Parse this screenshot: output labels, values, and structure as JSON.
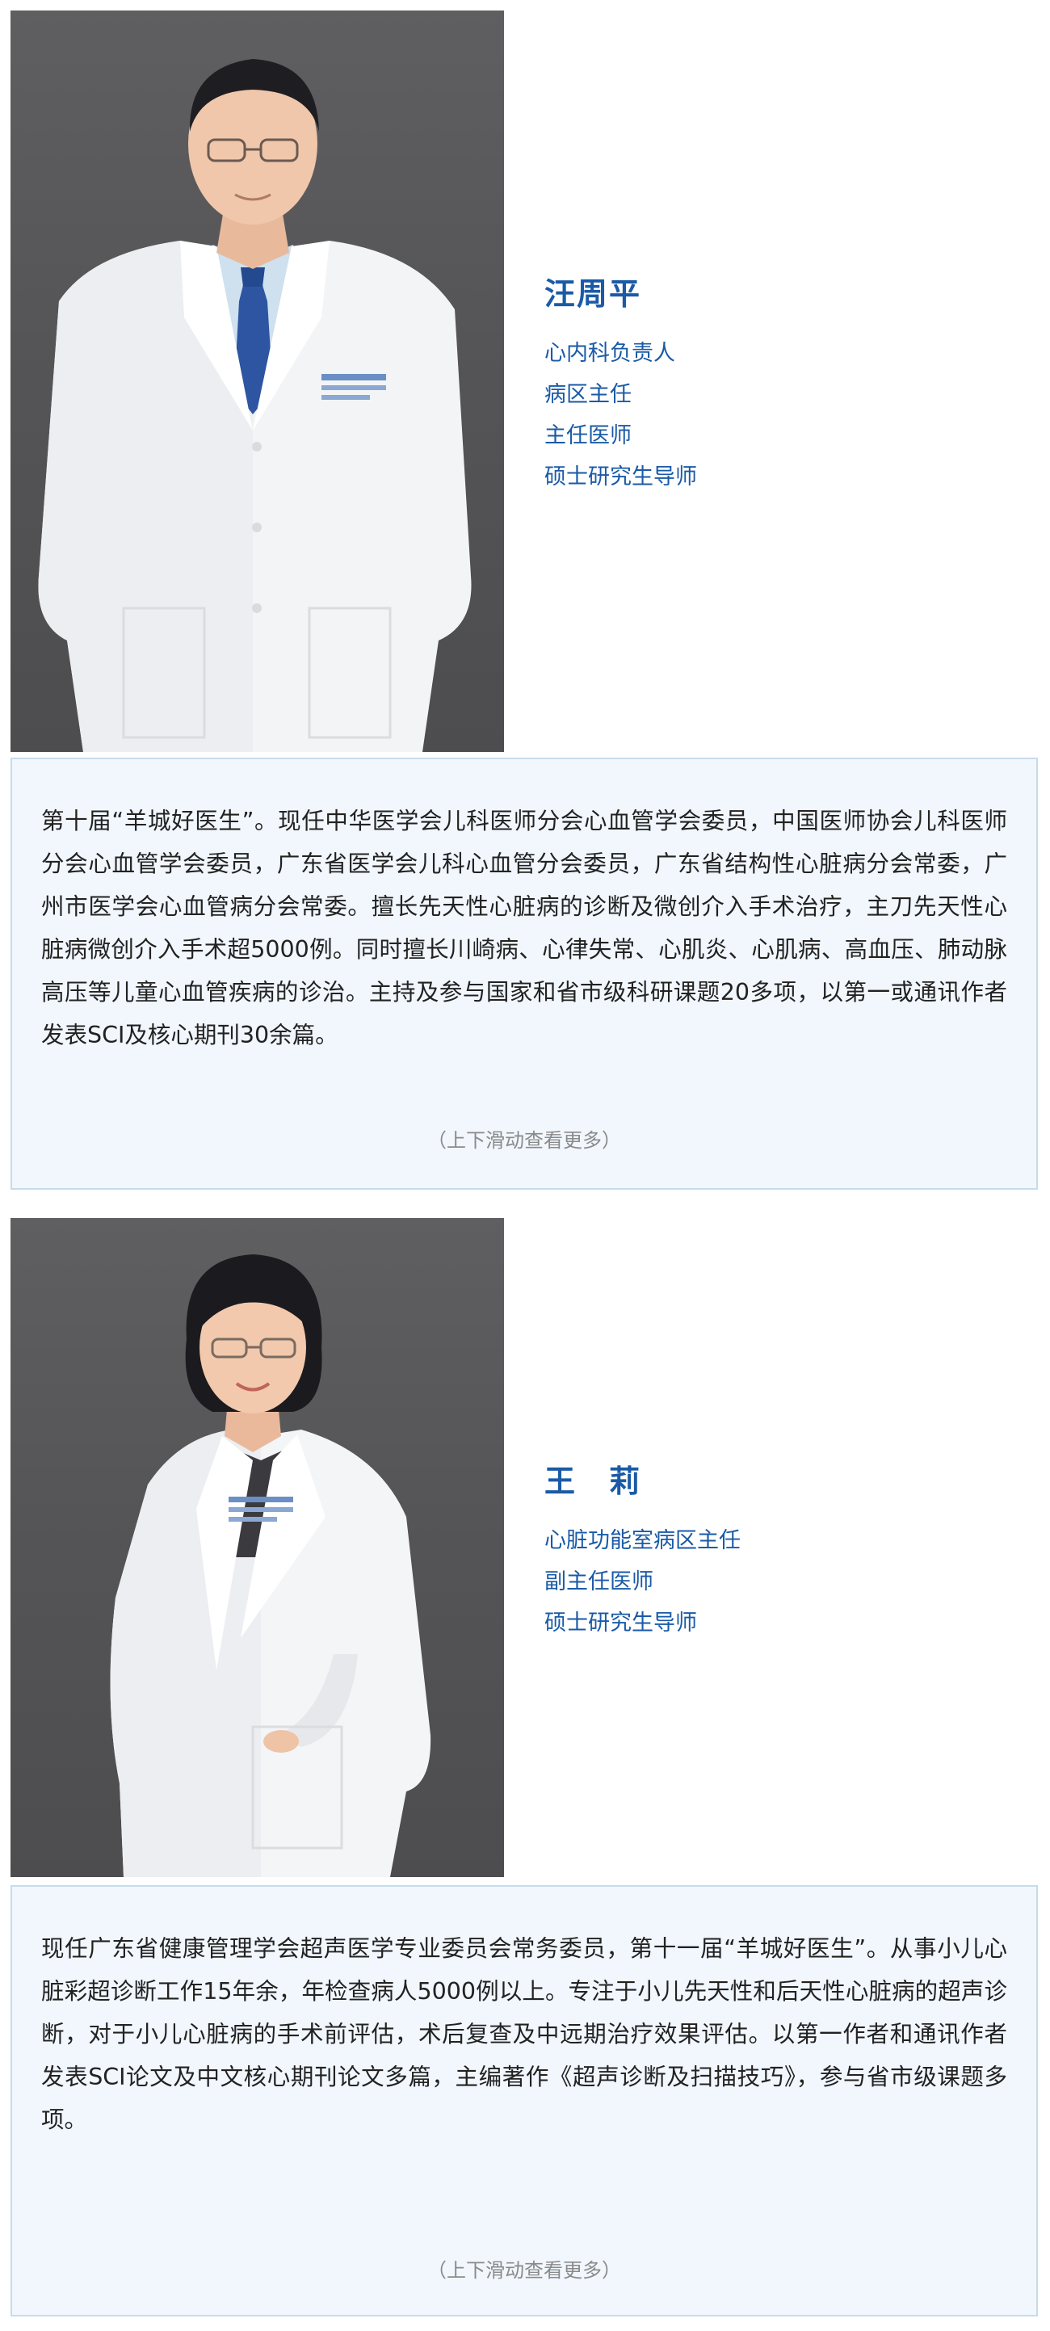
{
  "doctors": [
    {
      "name": "汪周平",
      "titles": [
        "心内科负责人",
        "病区主任",
        "主任医师",
        "硕士研究生导师"
      ],
      "bio": "第十届“羊城好医生”。现任中华医学会儿科医师分会心血管学会委员，中国医师协会儿科医师分会心血管学会委员，广东省医学会儿科心血管分会委员，广东省结构性心脏病分会常委，广州市医学会心血管病分会常委。擅长先天性心脏病的诊断及微创介入手术治疗，主刀先天性心脏病微创介入手术超5000例。同时擅长川崎病、心律失常、心肌炎、心肌病、高血压、肺动脉高压等儿童心血管疾病的诊治。主持及参与国家和省市级科研课题20多项，以第一或通讯作者发表SCI及核心期刊30余篇。",
      "hint": "（上下滑动查看更多）"
    },
    {
      "name": "王　莉",
      "titles": [
        "心脏功能室病区主任",
        "副主任医师",
        "硕士研究生导师"
      ],
      "bio": "现任广东省健康管理学会超声医学专业委员会常务委员，第十一届“羊城好医生”。从事小儿心脏彩超诊断工作15年余，年检查病人5000例以上。专注于小儿先天性和后天性心脏病的超声诊断，对于小儿心脏病的手术前评估，术后复查及中远期治疗效果评估。以第一作者和通讯作者发表SCI论文及中文核心期刊论文多篇，主编著作《超声诊断及扫描技巧》，参与省市级课题多项。",
      "hint": "（上下滑动查看更多）"
    }
  ],
  "colors": {
    "accent": "#1a5aa6",
    "card_bg": "#f1f7fd",
    "card_border": "#c5dced",
    "photo_bg": "#58585a"
  },
  "icons": [
    "doctor-portrait-male",
    "doctor-portrait-female"
  ]
}
